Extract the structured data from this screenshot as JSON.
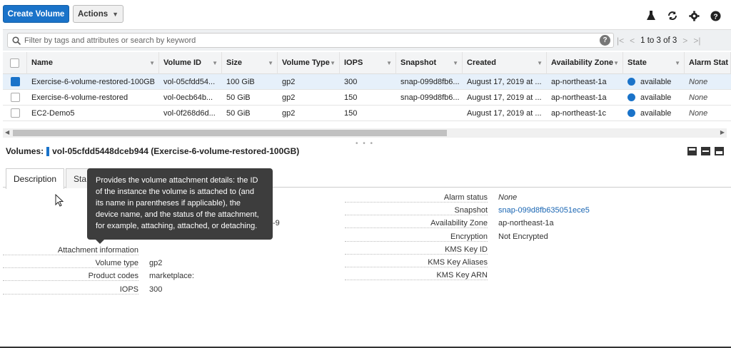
{
  "toolbar": {
    "create_label": "Create Volume",
    "actions_label": "Actions",
    "icons": [
      "flask-icon",
      "refresh-icon",
      "gear-icon",
      "help-icon"
    ]
  },
  "filter": {
    "placeholder": "Filter by tags and attributes or search by keyword",
    "pagination": "1 to 3 of 3"
  },
  "table": {
    "columns": [
      "Name",
      "Volume ID",
      "Size",
      "Volume Type",
      "IOPS",
      "Snapshot",
      "Created",
      "Availability Zone",
      "State",
      "Alarm Stat"
    ],
    "rows": [
      {
        "selected": true,
        "name": "Exercise-6-volume-restored-100GB",
        "volume_id": "vol-05cfdd54...",
        "size": "100 GiB",
        "type": "gp2",
        "iops": "300",
        "snapshot": "snap-099d8fb6...",
        "created": "August 17, 2019 at ...",
        "az": "ap-northeast-1a",
        "state": "available",
        "alarm": "None"
      },
      {
        "selected": false,
        "name": "Exercise-6-volume-restored",
        "volume_id": "vol-0ecb64b...",
        "size": "50 GiB",
        "type": "gp2",
        "iops": "150",
        "snapshot": "snap-099d8fb6...",
        "created": "August 17, 2019 at ...",
        "az": "ap-northeast-1a",
        "state": "available",
        "alarm": "None"
      },
      {
        "selected": false,
        "name": "EC2-Demo5",
        "volume_id": "vol-0f268d6d...",
        "size": "50 GiB",
        "type": "gp2",
        "iops": "150",
        "snapshot": "",
        "created": "August 17, 2019 at ...",
        "az": "ap-northeast-1c",
        "state": "available",
        "alarm": "None"
      }
    ]
  },
  "details": {
    "label": "Volumes:",
    "title": "vol-05cfdd5448dceb944 (Exercise-6-volume-restored-100GB)",
    "tabs": [
      "Description",
      "Sta"
    ],
    "left": [
      {
        "key": "Attachment information",
        "value": ""
      },
      {
        "key": "Volume type",
        "value": "gp2"
      },
      {
        "key": "Product codes",
        "value": "marketplace:"
      },
      {
        "key": "IOPS",
        "value": "300"
      }
    ],
    "partial_value": "-9",
    "right": [
      {
        "key": "Alarm status",
        "value": "None"
      },
      {
        "key": "Snapshot",
        "value": "snap-099d8fb635051ece5"
      },
      {
        "key": "Availability Zone",
        "value": "ap-northeast-1a"
      },
      {
        "key": "Encryption",
        "value": "Not Encrypted"
      },
      {
        "key": "KMS Key ID",
        "value": ""
      },
      {
        "key": "KMS Key Aliases",
        "value": ""
      },
      {
        "key": "KMS Key ARN",
        "value": ""
      }
    ]
  },
  "tooltip": {
    "text": "Provides the volume attachment details: the ID of the instance the volume is attached to (and its name in parentheses if applicable), the device name, and the status of the attachment, for example, attaching, attached, or detaching."
  },
  "colors": {
    "primary": "#1a73c9",
    "selected_row": "#e6f0fa",
    "tooltip_bg": "#3d3d3d",
    "link": "#1a66b3"
  }
}
